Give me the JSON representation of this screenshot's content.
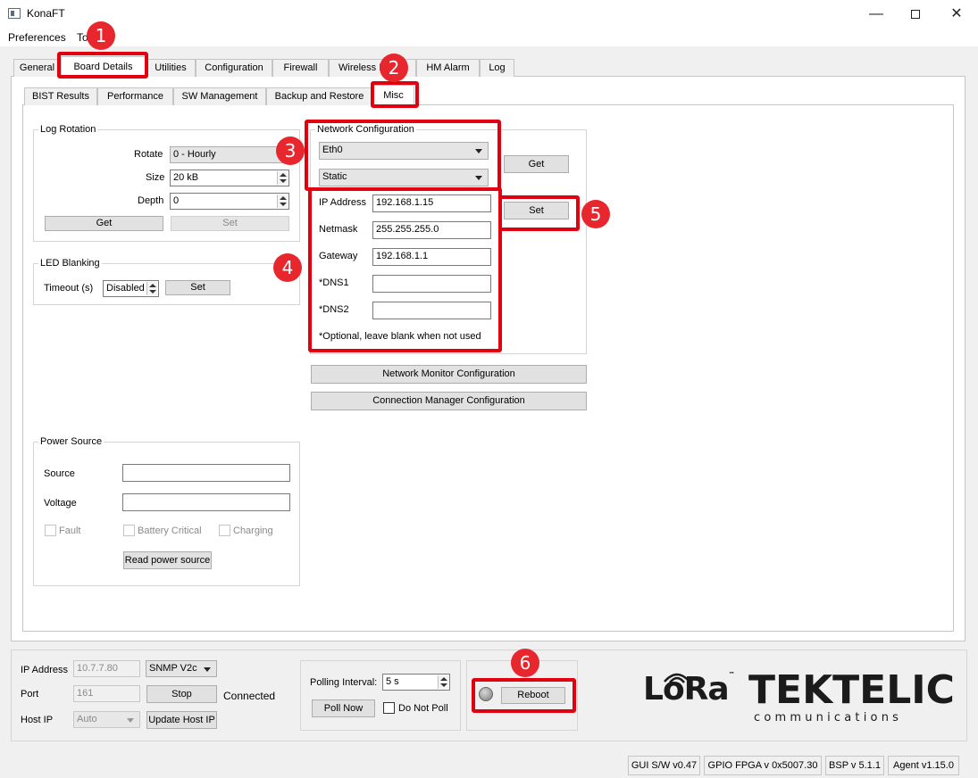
{
  "window": {
    "title": "KonaFT"
  },
  "menu": {
    "preferences": "Preferences",
    "tools": "To"
  },
  "tabs": [
    "General",
    "Board Details",
    "Utilities",
    "Configuration",
    "Firewall",
    "Wireless N",
    "HM Alarm",
    "Log"
  ],
  "subtabs": [
    "BIST Results",
    "Performance",
    "SW Management",
    "Backup and Restore",
    "Misc"
  ],
  "log_rotation": {
    "title": "Log Rotation",
    "rotate_label": "Rotate",
    "rotate_value": "0 - Hourly",
    "size_label": "Size",
    "size_value": "20 kB",
    "depth_label": "Depth",
    "depth_value": "0",
    "get": "Get",
    "set": "Set"
  },
  "led_blanking": {
    "title": "LED Blanking",
    "timeout_label": "Timeout (s)",
    "timeout_value": "Disabled",
    "set": "Set"
  },
  "power_source": {
    "title": "Power Source",
    "source_label": "Source",
    "voltage_label": "Voltage",
    "fault": "Fault",
    "battery_critical": "Battery Critical",
    "charging": "Charging",
    "read_button": "Read power source"
  },
  "network": {
    "title": "Network Configuration",
    "interface": "Eth0",
    "mode": "Static",
    "get": "Get",
    "set": "Set",
    "ip_label": "IP Address",
    "ip_value": "192.168.1.15",
    "netmask_label": "Netmask",
    "netmask_value": "255.255.255.0",
    "gateway_label": "Gateway",
    "gateway_value": "192.168.1.1",
    "dns1_label": "*DNS1",
    "dns2_label": "*DNS2",
    "note": "*Optional, leave blank when not used",
    "monitor_button": "Network Monitor Configuration",
    "conn_button": "Connection Manager Configuration"
  },
  "connection": {
    "ip_label": "IP Address",
    "ip_value": "10.7.7.80",
    "snmp": "SNMP V2c",
    "port_label": "Port",
    "port_value": "161",
    "stop": "Stop",
    "status": "Connected",
    "host_label": "Host IP",
    "host_value": "Auto",
    "update": "Update Host IP"
  },
  "polling": {
    "label": "Polling Interval:",
    "value": "5 s",
    "poll_now": "Poll Now",
    "do_not_poll": "Do Not Poll"
  },
  "reboot": {
    "label": "Reboot"
  },
  "logos": {
    "lora": "LoRa",
    "lora_tm": "™",
    "brand": "TEKTELIC",
    "brand_sub": "communications"
  },
  "status_bar": [
    "GUI S/W v0.47",
    "GPIO FPGA v 0x5007.30",
    "BSP v 5.1.1",
    "Agent v1.15.0"
  ],
  "badges": [
    "1",
    "2",
    "3",
    "4",
    "5",
    "6"
  ],
  "colors": {
    "highlight": "#e0000f",
    "badge": "#e8262d",
    "window_bg": "#f0f0f0"
  }
}
